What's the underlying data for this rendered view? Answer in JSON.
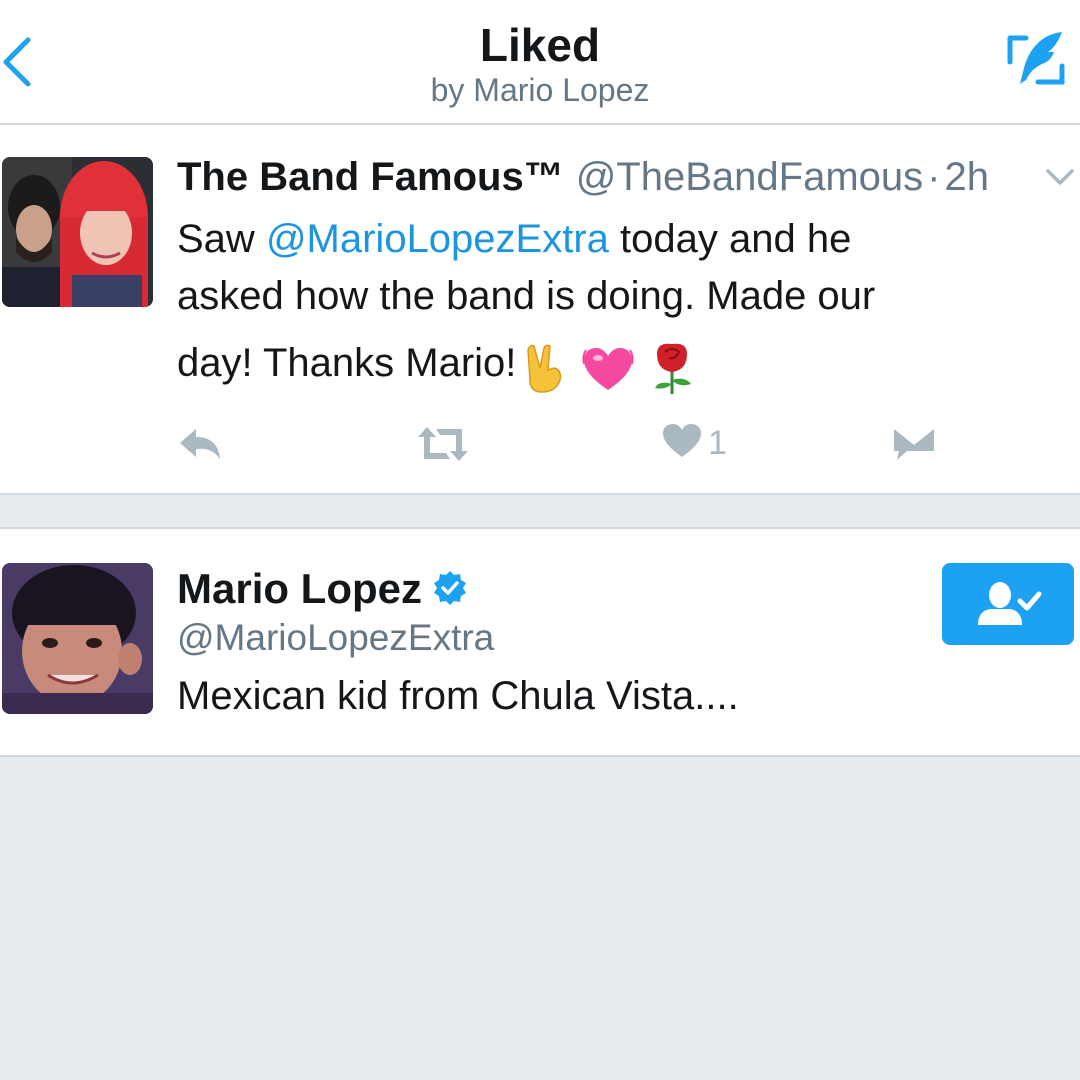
{
  "header": {
    "title": "Liked",
    "subtitle": "by Mario Lopez",
    "back_icon": "chevron-left-icon",
    "compose_icon": "compose-tweet-icon"
  },
  "tweet": {
    "author_name": "The Band Famous™",
    "author_handle": "@TheBandFamous",
    "separator": "·",
    "time": "2h",
    "text_part1": "Saw ",
    "mention": "@MarioLopezExtra",
    "text_part2": " today and he",
    "line2": "asked how the band is doing. Made our",
    "line3": "day! Thanks Mario!",
    "emojis": [
      "victory-hand",
      "beating-heart",
      "rose"
    ],
    "like_count": "1"
  },
  "user": {
    "name": "Mario Lopez",
    "handle": "@MarioLopezExtra",
    "bio": "Mexican kid from Chula Vista....",
    "verified": true,
    "following": true
  },
  "colors": {
    "accent": "#1da1f2",
    "link": "#1b95e0",
    "muted": "#657786",
    "action_gray": "#aab8c2",
    "background": "#e6ecf0"
  }
}
